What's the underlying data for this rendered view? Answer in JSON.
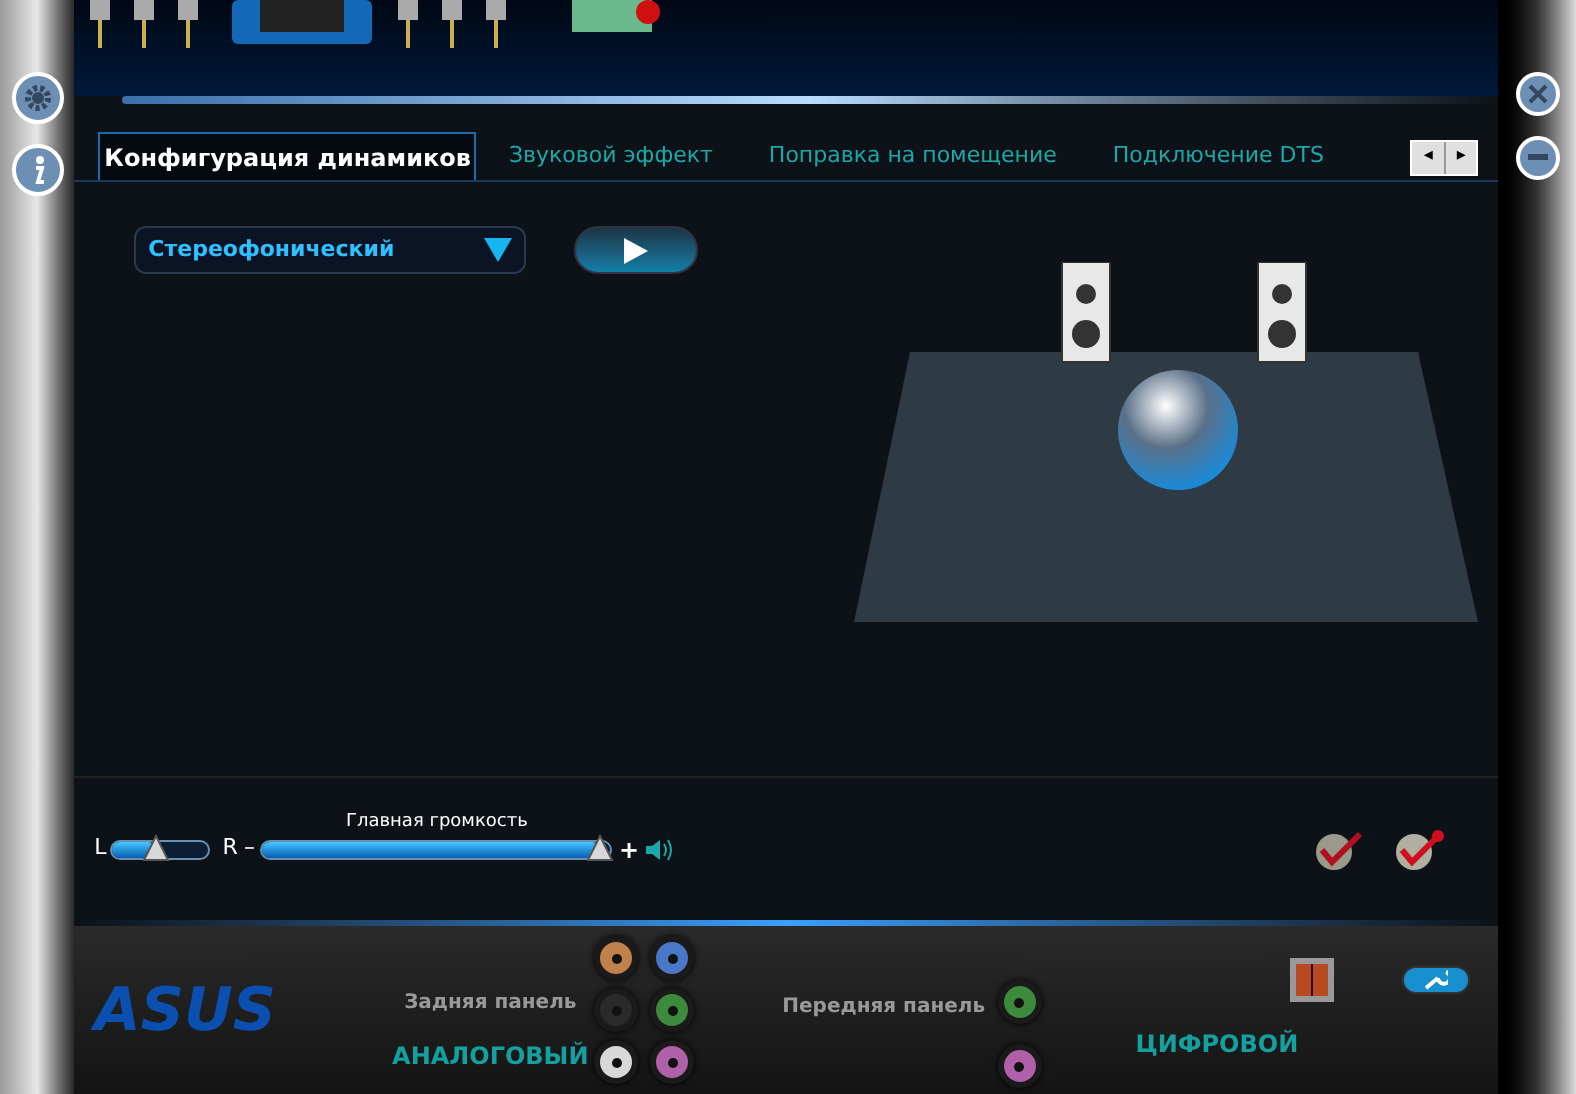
{
  "tabs": [
    {
      "label": "Конфигурация динамиков",
      "selected": true
    },
    {
      "label": "Звуковой эффект",
      "selected": false
    },
    {
      "label": "Поправка на помещение",
      "selected": false
    },
    {
      "label": "Подключение DTS",
      "selected": false
    }
  ],
  "tab_scroll": {
    "left": "◂",
    "right": "▸"
  },
  "speaker_config": {
    "value": "Стереофонический"
  },
  "balance": {
    "left_label": "L",
    "right_label": "R",
    "level": 0.45
  },
  "master_volume": {
    "label": "Главная громкость",
    "minus": "–",
    "plus": "+",
    "level": 0.97
  },
  "logo": "ASUS",
  "rear_panel": {
    "label": "Задняя панель",
    "jacks": [
      {
        "color": "#c0824a"
      },
      {
        "color": "#4a78c8"
      },
      {
        "color": "#2a2a2a"
      },
      {
        "color": "#3d8a3d"
      },
      {
        "color": "#d8d8d8"
      },
      {
        "color": "#b060a8"
      }
    ]
  },
  "front_panel": {
    "label": "Передняя панель",
    "jacks": [
      {
        "color": "#3d8a3d"
      },
      {
        "color": "#b060a8"
      }
    ]
  },
  "analog_label": "АНАЛОГОВЫЙ",
  "digital_label": "ЦИФРОВОЙ"
}
